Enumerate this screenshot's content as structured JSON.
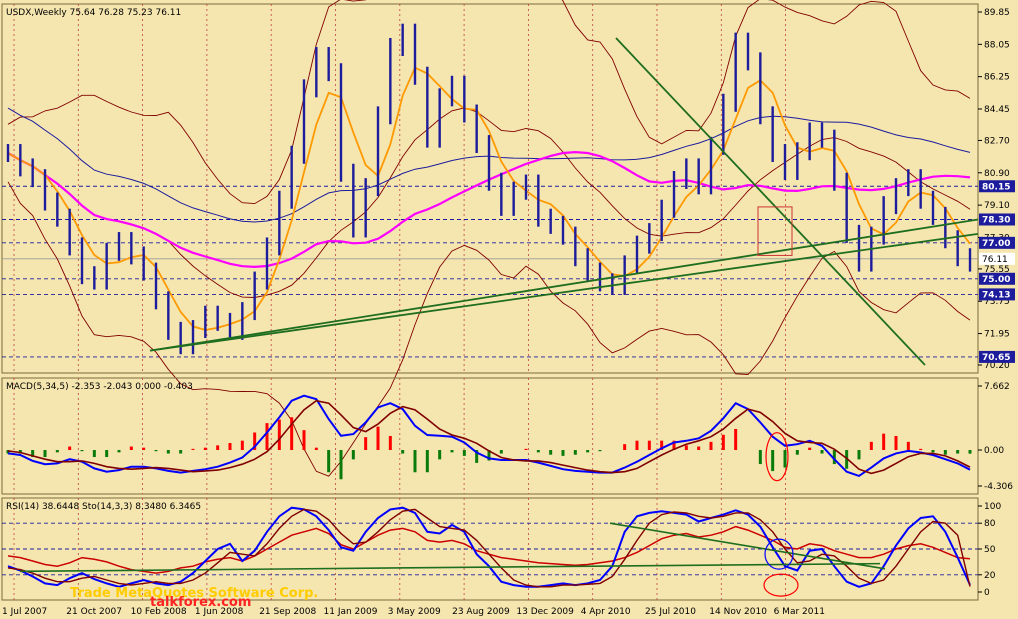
{
  "chart_data": [
    {
      "type": "line",
      "title": "USDX,Weekly  75.64 76.28 75.23 76.11",
      "y_ticks": [
        "89.85",
        "88.05",
        "86.25",
        "84.45",
        "82.70",
        "80.90",
        "79.10",
        "77.30",
        "75.55",
        "73.75",
        "71.95",
        "70.20"
      ],
      "ylim": [
        70.2,
        89.85
      ],
      "h_levels": [
        {
          "label": "80.15",
          "value": 80.15,
          "color": "#1c1c9c"
        },
        {
          "label": "78.30",
          "value": 78.3,
          "color": "#1c1c9c"
        },
        {
          "label": "77.00",
          "value": 77.0,
          "color": "#1c1c9c"
        },
        {
          "label": "76.11",
          "value": 76.11,
          "color": "#9a9a9a"
        },
        {
          "label": "75.00",
          "value": 75.0,
          "color": "#1c1c9c"
        },
        {
          "label": "74.13",
          "value": 74.13,
          "color": "#1c1c9c"
        },
        {
          "label": "70.65",
          "value": 70.65,
          "color": "#1c1c9c"
        }
      ],
      "series": [
        {
          "values": [
            82.0,
            81.2,
            80.6,
            79.3,
            78.4,
            76.8,
            75.2,
            74.9,
            76.5,
            77.1,
            76.3,
            75.4,
            73.8,
            72.1,
            71.3,
            72.2,
            73.0,
            72.6,
            72.1,
            73.2,
            74.9,
            76.8,
            79.4,
            81.9,
            85.6,
            87.4,
            86.5,
            80.9,
            77.8,
            80.1,
            84.1,
            87.9,
            88.7,
            86.3,
            82.8,
            85.1,
            85.8,
            84.2,
            82.5,
            80.4,
            79.0,
            79.9,
            80.3,
            78.4,
            78.0,
            77.4,
            76.2,
            75.4,
            74.8,
            74.6,
            75.8,
            76.9,
            77.6,
            78.9,
            80.5,
            81.2,
            80.2,
            82.4,
            84.8,
            88.2,
            87.1,
            84.1,
            82.0,
            81.0,
            82.1,
            83.2,
            82.8,
            80.4,
            77.5,
            75.9,
            77.4,
            79.1,
            80.1,
            80.6,
            79.4,
            78.5,
            77.2,
            76.2,
            75.9
          ]
        }
      ]
    },
    {
      "type": "line",
      "title": "MACD(5,34,5) -2.353 -2.043 0.000 -0.403",
      "y_ticks": [
        "7.662",
        "0.00",
        "-4.306"
      ],
      "ylim": [
        -4.306,
        7.662
      ],
      "series": [
        {
          "values": [
            -0.4,
            -0.6,
            -1.3,
            -1.7,
            -1.6,
            -1.1,
            -1.4,
            -2.2,
            -2.6,
            -2.4,
            -2.0,
            -2.0,
            -2.2,
            -2.5,
            -2.7,
            -2.5,
            -2.3,
            -2.0,
            -1.5,
            -0.9,
            0.4,
            2.1,
            3.9,
            5.9,
            6.5,
            6.1,
            3.7,
            1.7,
            1.9,
            3.3,
            5.1,
            5.6,
            4.9,
            2.9,
            1.8,
            1.7,
            1.6,
            0.9,
            -0.3,
            -1.0,
            -1.2,
            -1.2,
            -1.2,
            -1.5,
            -1.9,
            -2.3,
            -2.5,
            -2.6,
            -2.7,
            -2.7,
            -2.1,
            -1.4,
            -0.6,
            0.2,
            0.9,
            1.1,
            1.4,
            2.3,
            3.8,
            5.6,
            4.9,
            3.3,
            1.6,
            0.5,
            0.7,
            1.1,
            0.5,
            -1.1,
            -2.6,
            -3.1,
            -2.1,
            -1.0,
            -0.4,
            -0.1,
            -0.3,
            -0.6,
            -1.1,
            -1.6,
            -2.35
          ]
        },
        {
          "values": [
            -0.1,
            -0.3,
            -0.7,
            -1.1,
            -1.4,
            -1.4,
            -1.3,
            -1.6,
            -2.0,
            -2.2,
            -2.3,
            -2.2,
            -2.1,
            -2.2,
            -2.4,
            -2.6,
            -2.5,
            -2.4,
            -2.1,
            -1.7,
            -1.1,
            -0.2,
            1.3,
            3.1,
            4.8,
            5.9,
            5.6,
            4.2,
            2.7,
            2.2,
            3.1,
            4.4,
            5.2,
            4.8,
            3.7,
            2.5,
            1.8,
            1.4,
            0.8,
            -0.1,
            -0.9,
            -1.2,
            -1.3,
            -1.3,
            -1.5,
            -1.8,
            -2.1,
            -2.4,
            -2.6,
            -2.7,
            -2.6,
            -2.2,
            -1.4,
            -0.6,
            0.1,
            0.7,
            1.1,
            1.6,
            2.5,
            3.8,
            4.9,
            4.5,
            3.4,
            2.0,
            1.1,
            0.9,
            0.8,
            0.1,
            -1.0,
            -2.3,
            -2.8,
            -2.4,
            -1.6,
            -0.8,
            -0.4,
            -0.4,
            -0.7,
            -1.3,
            -2.04
          ]
        }
      ]
    },
    {
      "type": "line",
      "title": "RSI(14) 38.6448  Sto(14,3,3) 8.3480 6.3465",
      "y_ticks": [
        "100",
        "80",
        "50",
        "20",
        "0"
      ],
      "ylim": [
        0,
        100
      ],
      "h_levels": [
        {
          "label": "80",
          "value": 80,
          "color": "#1c1c9c"
        },
        {
          "label": "50",
          "value": 50,
          "color": "#1c1c9c"
        },
        {
          "label": "20",
          "value": 20,
          "color": "#1c1c9c"
        }
      ],
      "series": [
        {
          "values": [
            42,
            40,
            36,
            32,
            30,
            34,
            40,
            38,
            35,
            30,
            26,
            24,
            22,
            24,
            28,
            30,
            35,
            38,
            40,
            36,
            42,
            50,
            58,
            66,
            70,
            74,
            68,
            55,
            50,
            58,
            66,
            72,
            74,
            70,
            60,
            58,
            60,
            56,
            48,
            44,
            40,
            38,
            36,
            34,
            33,
            32,
            31,
            32,
            34,
            36,
            40,
            46,
            54,
            62,
            66,
            68,
            64,
            66,
            70,
            76,
            72,
            66,
            60,
            52,
            50,
            56,
            54,
            48,
            44,
            40,
            40,
            44,
            50,
            54,
            56,
            52,
            46,
            40,
            38.6
          ]
        },
        {
          "values": [
            30,
            25,
            18,
            10,
            8,
            16,
            22,
            15,
            10,
            6,
            10,
            14,
            10,
            8,
            12,
            22,
            36,
            50,
            56,
            36,
            48,
            70,
            88,
            98,
            96,
            88,
            72,
            52,
            48,
            70,
            86,
            96,
            98,
            92,
            70,
            68,
            78,
            70,
            44,
            30,
            12,
            8,
            6,
            6,
            8,
            10,
            8,
            10,
            14,
            30,
            70,
            88,
            92,
            94,
            92,
            90,
            82,
            86,
            90,
            95,
            90,
            76,
            52,
            30,
            25,
            48,
            50,
            30,
            12,
            6,
            10,
            30,
            54,
            74,
            86,
            88,
            70,
            40,
            8.3
          ]
        },
        {
          "values": [
            28,
            26,
            22,
            16,
            12,
            12,
            16,
            18,
            14,
            10,
            8,
            10,
            12,
            10,
            10,
            14,
            22,
            34,
            46,
            44,
            42,
            56,
            74,
            88,
            96,
            94,
            84,
            68,
            56,
            58,
            70,
            84,
            94,
            96,
            86,
            76,
            74,
            72,
            60,
            44,
            28,
            14,
            8,
            6,
            6,
            8,
            8,
            9,
            10,
            18,
            38,
            60,
            80,
            90,
            93,
            92,
            88,
            86,
            88,
            92,
            92,
            84,
            70,
            50,
            34,
            36,
            44,
            42,
            30,
            16,
            10,
            14,
            30,
            50,
            70,
            82,
            80,
            66,
            6.3
          ]
        }
      ]
    }
  ],
  "x_labels": [
    "1 Jul 2007",
    "21 Oct 2007",
    "10 Feb 2008",
    "1 Jun 2008",
    "21 Sep 2008",
    "11 Jan 2009",
    "3 May 2009",
    "23 Aug 2009",
    "13 Dec 2009",
    "4 Apr 2010",
    "25 Jul 2010",
    "14 Nov 2010",
    "6 Mar 2011"
  ],
  "watermark": "Trade  MetaQuotes Software Corp.",
  "watermark_site": "talkforex.com",
  "colors": {
    "background": "#f5e6b0",
    "price": "#1c1c9c",
    "macd": "#0000ff",
    "signal": "#800000",
    "rsi": "#cc0000",
    "sto_main": "#0000ff",
    "sto_signal": "#800000",
    "trend": "#1f6e1f",
    "ma_fast": "#ff9900",
    "ma_slow": "#ff00ff",
    "ma_200": "#1c1c9c",
    "bands": "#800000",
    "hist_pos": "#ff0000",
    "hist_neg": "#0a7a0a"
  }
}
